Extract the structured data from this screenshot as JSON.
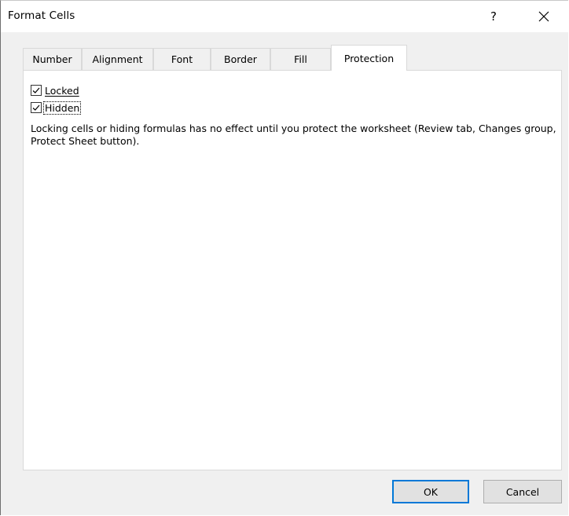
{
  "window": {
    "title": "Format Cells",
    "help_label": "?"
  },
  "tabs": [
    {
      "label": "Number",
      "active": false
    },
    {
      "label": "Alignment",
      "active": false
    },
    {
      "label": "Font",
      "active": false
    },
    {
      "label": "Border",
      "active": false
    },
    {
      "label": "Fill",
      "active": false
    },
    {
      "label": "Protection",
      "active": true
    }
  ],
  "protection": {
    "locked": {
      "label": "Locked",
      "checked": true
    },
    "hidden": {
      "label": "Hidden",
      "checked": true
    },
    "note": "Locking cells or hiding formulas has no effect until you protect the worksheet (Review tab, Changes group, Protect Sheet button)."
  },
  "buttons": {
    "ok": "OK",
    "cancel": "Cancel"
  },
  "colors": {
    "accent": "#0078d7",
    "dialog_bg": "#f0f0f0",
    "panel_bg": "#ffffff"
  }
}
